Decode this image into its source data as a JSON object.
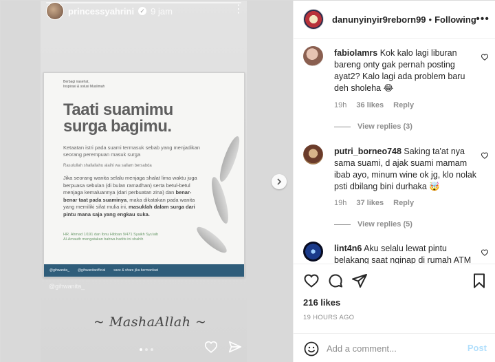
{
  "story": {
    "username": "princessyahrini",
    "time": "9 jam",
    "card": {
      "small_lines": [
        "Berbagi nasehat,",
        "Inspirasi & solusi Muslimah"
      ],
      "title_line1": "Taati suamimu",
      "title_line2": "surga bagimu.",
      "subtitle": "Ketaatan istri pada suami termasuk sebab yang menjadikan seorang perempuan masuk surga",
      "cite": "Rasulullah shallallahu alaihi wa sallam bersabda",
      "body_plain1": "Jika seorang wanita selalu menjaga shalat lima waktu juga berpuasa sebulan (di bulan ramadhan) serta betul-betul menjaga kemaluannya (dari perbuatan zina) dan ",
      "body_bold1": "benar-benar taat pada suaminya",
      "body_plain2": ", maka dikatakan pada wanita yang memiliki sifat mulia ini, ",
      "body_bold2": "masuklah dalam surga dari pintu mana saja yang engkau suka.",
      "ref1": "HR. Ahmad 1/191 dan Ibnu Hibban 9/471 Syaikh Syu'aib",
      "ref2": "Al-Arnauth mengatakan bahwa hadits ini shahih",
      "bar_items": [
        "@gihwanita_",
        "@gihwanitaofficial",
        "save & share jika bermanfaat"
      ]
    },
    "caption": "~ MashaAllah ~"
  },
  "post": {
    "username": "danunyinyir9reborn99",
    "separator": "•",
    "follow_label": "Following",
    "comments": [
      {
        "user": "fabiolamrs",
        "text": "Kok kalo lagi liburan bareng onty gak pernah posting ayat2? Kalo lagi ada problem baru deh sholeha 😂",
        "time": "19h",
        "likes": "36 likes",
        "reply": "Reply",
        "view_replies": "View replies (3)"
      },
      {
        "user": "putri_borneo748",
        "text": "Saking ta'at nya sama suami, d ajak suami mamam ibab ayo, minum wine ok jg, klo nolak psti dbilang bini durhaka 🤯",
        "time": "19h",
        "likes": "37 likes",
        "reply": "Reply",
        "view_replies": "View replies (5)"
      },
      {
        "user": "lint4n6",
        "text": "Aku selalu lewat pintu belakang saat nginap di rumah ATM"
      }
    ],
    "likes_count": "216 likes",
    "timestamp": "19 HOURS AGO",
    "comment_placeholder": "Add a comment...",
    "post_label": "Post"
  },
  "icons": {
    "heart": "heart-icon",
    "comment": "comment-icon",
    "share": "send-icon",
    "save": "bookmark-icon",
    "emoji": "emoji-icon",
    "next": "chevron-right-icon",
    "more": "more-icon"
  },
  "colors": {
    "text": "#262626",
    "muted": "#8e8e8e",
    "post_button": "#b2dffc",
    "card_bar": "#2f5d7a"
  }
}
